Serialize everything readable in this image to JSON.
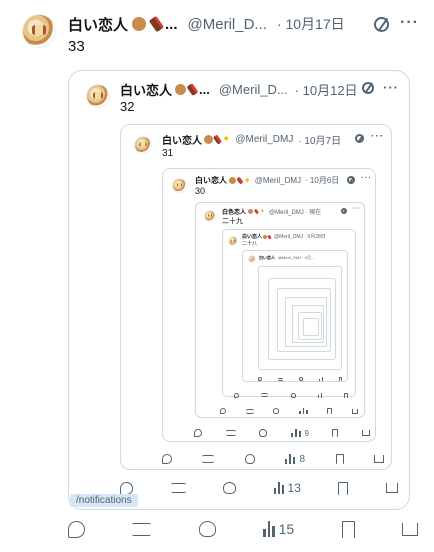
{
  "tweet": {
    "name": "白い恋人",
    "handle": "@Meril_D...",
    "date": "· 10月17日",
    "more": "···",
    "text": "33",
    "replies": "",
    "retweets": "",
    "likes": "",
    "views": "15"
  },
  "quote1": {
    "name": "白い恋人",
    "handle": "@Meril_D...",
    "date": "· 10月12日",
    "text": "32",
    "views": "13"
  },
  "quote2": {
    "name": "白い恋人",
    "handle": "@Meril_DMJ",
    "date": "· 10月7日",
    "text": "31",
    "views": "8"
  },
  "quote3": {
    "name": "白い恋人",
    "handle": "@Meril_DMJ",
    "date": "· 10月6日",
    "text": "30",
    "views": "9"
  },
  "quote4": {
    "name": "白色恋人",
    "handle": "@Meril_DMJ · 現在",
    "text": "二十九"
  },
  "quote5": {
    "name": "白い恋人",
    "handle": "@Meril_DMJ · 9月28日",
    "text": "二十八"
  },
  "quote6": {
    "name": "白い恋人",
    "handle": "@Meril_DMJ · 9月..."
  },
  "tooltip": "/notifications",
  "icons": [
    "reply-icon",
    "retweet-icon",
    "like-icon",
    "views-icon",
    "bookmark-icon",
    "share-icon",
    "grok-icon"
  ]
}
